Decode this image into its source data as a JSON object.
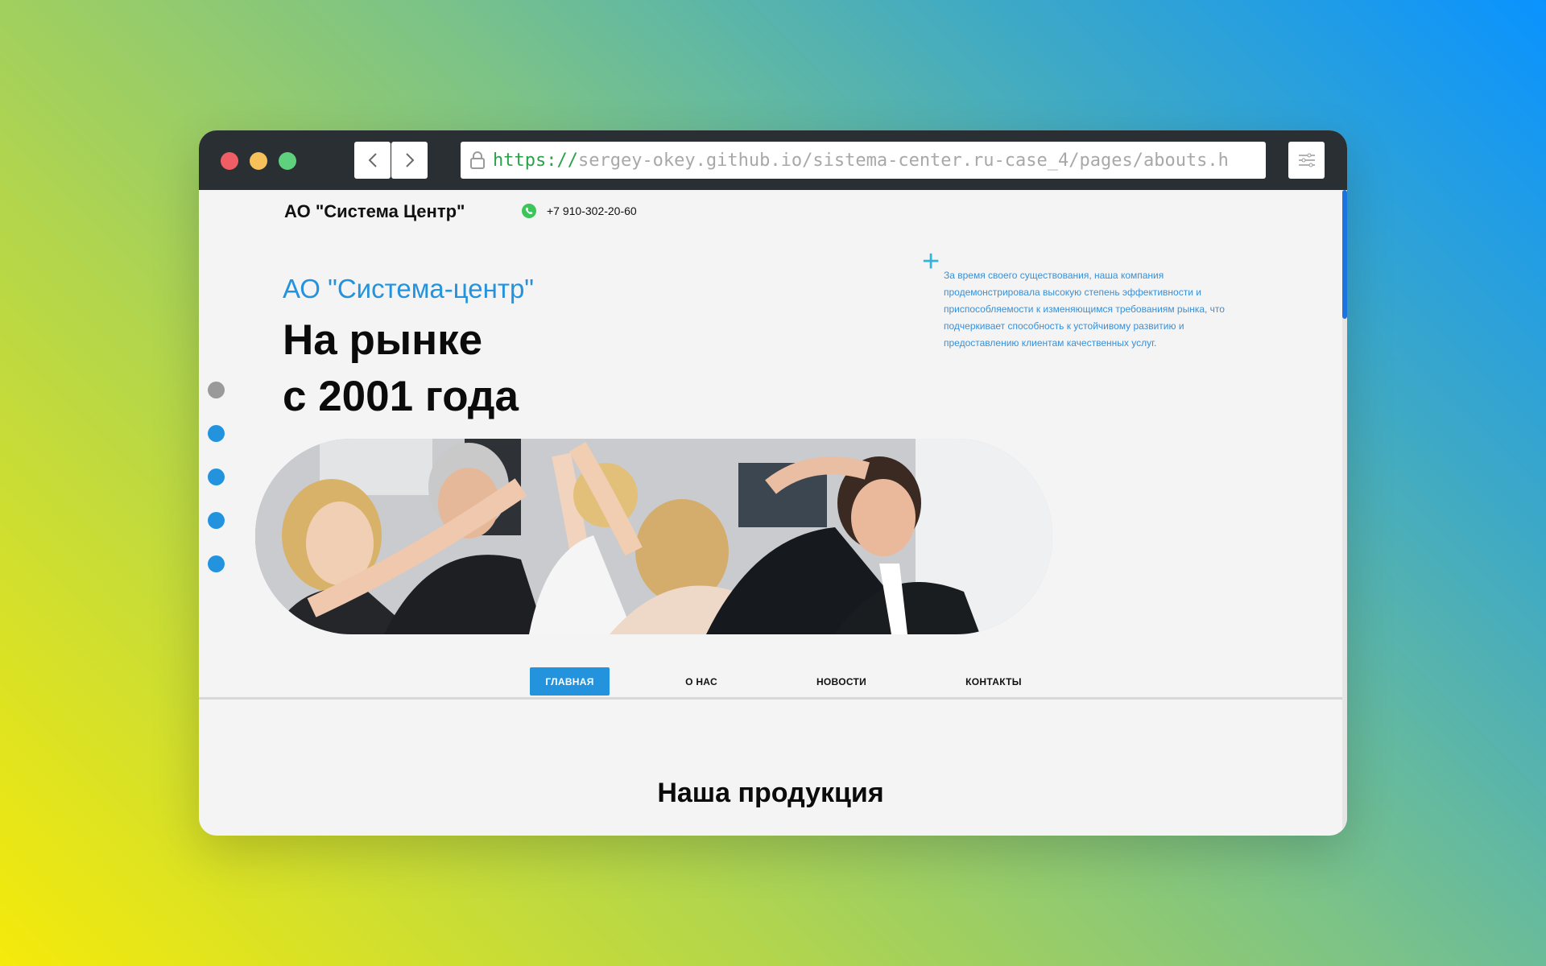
{
  "browser": {
    "url_scheme": "https://",
    "url_rest": "sergey-okey.github.io/sistema-center.ru-case_4/pages/abouts.h",
    "back_icon": "chevron-left-icon",
    "forward_icon": "chevron-right-icon",
    "menu_icon": "sliders-icon",
    "lock_icon": "lock-icon"
  },
  "header": {
    "brand": "АО \"Система Центр\"",
    "phone": "+7 910-302-20-60",
    "phone_icon": "whatsapp-icon"
  },
  "hero": {
    "subtitle": "АО \"Система-центр\"",
    "headline_line1": "На рынке",
    "headline_line2": "с 2001 года",
    "description": "За время своего существования, наша компания продемонстрировала высокую степень эффективности и приспособляемости к изменяющимся требованиям рынка, что подчеркивает способность к устойчивому развитию и предоставлению клиентам качественных услуг.",
    "plus_symbol": "+"
  },
  "nav": {
    "items": [
      {
        "label": "ГЛАВНАЯ",
        "active": true
      },
      {
        "label": "О НАС",
        "active": false
      },
      {
        "label": "НОВОСТИ",
        "active": false
      },
      {
        "label": "КОНТАКТЫ",
        "active": false
      }
    ]
  },
  "products": {
    "title": "Наша продукция"
  },
  "colors": {
    "accent": "#2493de",
    "chrome": "#2a2f34",
    "url_scheme": "#2aa24a"
  }
}
